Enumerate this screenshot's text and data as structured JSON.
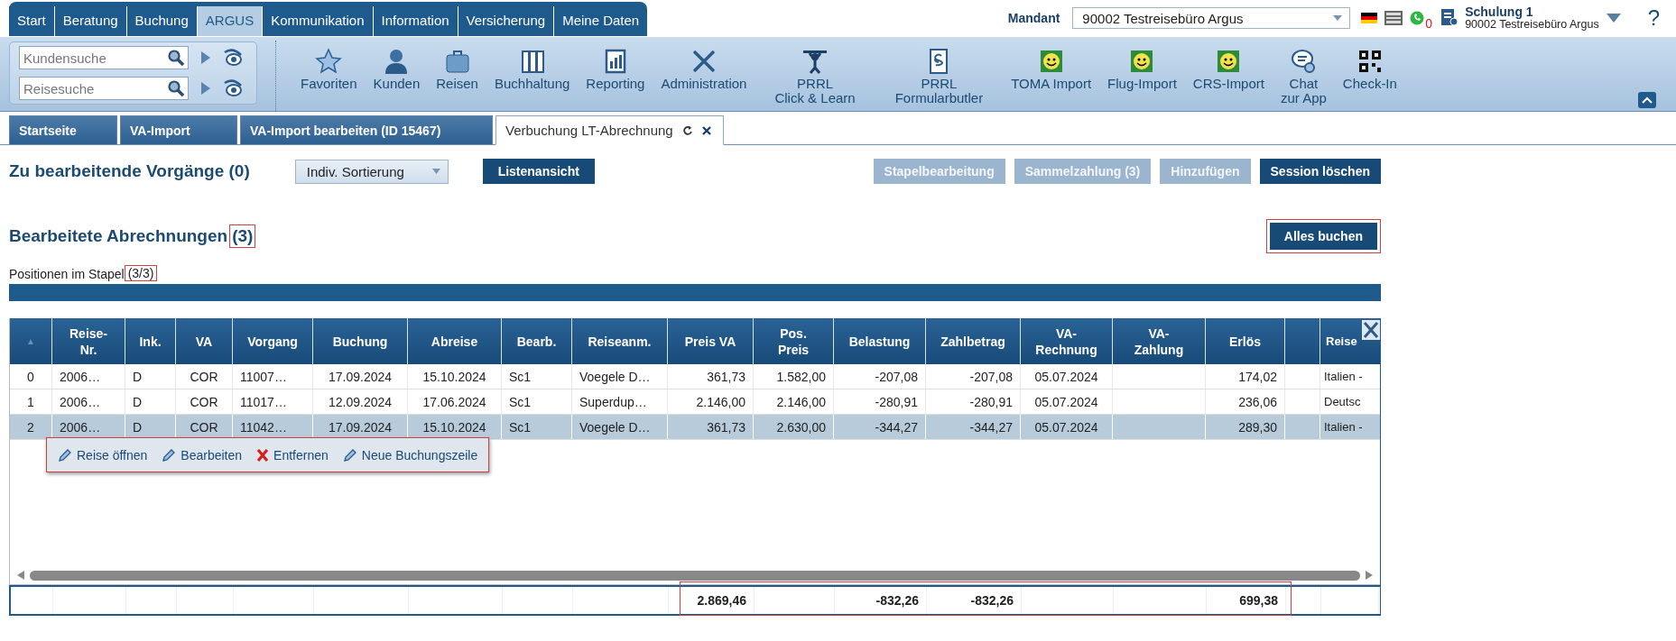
{
  "main_nav": {
    "tabs": [
      {
        "label": "Start",
        "selected": false
      },
      {
        "label": "Beratung",
        "selected": false
      },
      {
        "label": "Buchung",
        "selected": false
      },
      {
        "label": "ARGUS",
        "selected": true
      },
      {
        "label": "Kommunikation",
        "selected": false
      },
      {
        "label": "Information",
        "selected": false
      },
      {
        "label": "Versicherung",
        "selected": false
      },
      {
        "label": "Meine Daten",
        "selected": false
      }
    ]
  },
  "mandant": {
    "label": "Mandant",
    "value": "90002 Testreisebüro Argus"
  },
  "notifications": {
    "whatsapp_count": "0"
  },
  "user": {
    "name": "Schulung 1",
    "office": "90002 Testreisebüro Argus"
  },
  "help": "?",
  "searches": [
    {
      "placeholder": "Kundensuche"
    },
    {
      "placeholder": "Reisesuche"
    }
  ],
  "toolbar": [
    {
      "label": "Favoriten"
    },
    {
      "label": "Kunden"
    },
    {
      "label": "Reisen"
    },
    {
      "label": "Buchhaltung"
    },
    {
      "label": "Reporting"
    },
    {
      "label": "Administration"
    },
    {
      "label": "PRRL\nClick & Learn"
    },
    {
      "label": "PRRL\nFormularbutler"
    },
    {
      "label": "TOMA Import"
    },
    {
      "label": "Flug-Import"
    },
    {
      "label": "CRS-Import"
    },
    {
      "label": "Chat\nzur App"
    },
    {
      "label": "Check-In"
    }
  ],
  "page_tabs": [
    {
      "label": "Startseite",
      "selected": false
    },
    {
      "label": "VA-Import",
      "selected": false
    },
    {
      "label": "VA-Import bearbeiten (ID 15467)",
      "selected": false
    },
    {
      "label": "Verbuchung LT-Abrechnung",
      "selected": true
    }
  ],
  "pending": {
    "title": "Zu bearbeitende Vorgänge (0)",
    "sort": "Indiv. Sortierung",
    "list_button": "Listenansicht",
    "actions": [
      {
        "label": "Stapelbearbeitung",
        "disabled": true
      },
      {
        "label": "Sammelzahlung (3)",
        "disabled": true
      },
      {
        "label": "Hinzufügen",
        "disabled": true
      },
      {
        "label": "Session löschen",
        "disabled": false
      }
    ]
  },
  "processed": {
    "title": "Bearbeitete Abrechnungen",
    "count": "(3)",
    "count_highlighted": true,
    "book_all": {
      "label": "Alles buchen",
      "highlighted": true
    },
    "stack_label": "Positionen im Stapel",
    "stack_count": "(3/3)",
    "stack_count_highlighted": true,
    "stack_progress": {
      "level": 1
    }
  },
  "table": {
    "columns": [
      {
        "label": "▲"
      },
      {
        "label": "Reise-\nNr."
      },
      {
        "label": "Ink."
      },
      {
        "label": "VA"
      },
      {
        "label": "Vorgang"
      },
      {
        "label": "Buchung"
      },
      {
        "label": "Abreise"
      },
      {
        "label": "Bearb."
      },
      {
        "label": "Reiseanm."
      },
      {
        "label": "Preis VA",
        "total": "2.869,46"
      },
      {
        "label": "Pos.\nPreis"
      },
      {
        "label": "Belastung",
        "total": "-832,26"
      },
      {
        "label": "Zahlbetrag",
        "total": "-832,26"
      },
      {
        "label": "VA-\nRechnung"
      },
      {
        "label": "VA-\nZahlung"
      },
      {
        "label": "Erlös",
        "total": "699,38"
      },
      {},
      {
        "label": "Reise"
      }
    ],
    "rows": [
      {
        "selected": false,
        "cells": [
          "0",
          "2006…",
          "D",
          "COR",
          "11007…",
          "17.09.2024",
          "15.10.2024",
          "Sc1",
          "Voegele D…",
          "361,73",
          "1.582,00",
          "-207,08",
          "-207,08",
          "05.07.2024",
          "",
          "174,02",
          "",
          "Italien -"
        ]
      },
      {
        "selected": false,
        "cells": [
          "1",
          "2006…",
          "D",
          "COR",
          "11017…",
          "12.09.2024",
          "17.06.2024",
          "Sc1",
          "Superdup…",
          "2.146,00",
          "2.146,00",
          "-280,91",
          "-280,91",
          "05.07.2024",
          "",
          "236,06",
          "",
          "Deutsc"
        ]
      },
      {
        "selected": true,
        "cells": [
          "2",
          "2006…",
          "D",
          "COR",
          "11042…",
          "17.09.2024",
          "15.10.2024",
          "Sc1",
          "Voegele D…",
          "361,73",
          "2.630,00",
          "-344,27",
          "-344,27",
          "05.07.2024",
          "",
          "289,30",
          "",
          "Italien -"
        ]
      }
    ],
    "totals_highlighted": true,
    "context_menu": {
      "highlighted": true,
      "items": [
        {
          "label": "Reise öffnen",
          "kind": "edit"
        },
        {
          "label": "Bearbeiten",
          "kind": "edit"
        },
        {
          "label": "Entfernen",
          "kind": "remove"
        },
        {
          "label": "Neue Buchungszeile",
          "kind": "edit"
        }
      ]
    }
  }
}
